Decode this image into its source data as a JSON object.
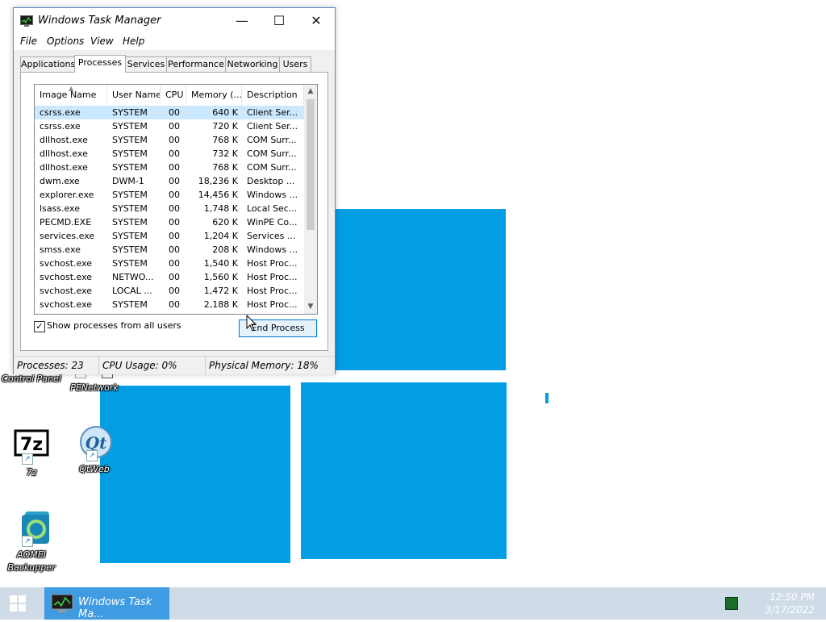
{
  "desktop": {
    "icons": [
      {
        "label": "Control Panel"
      },
      {
        "label": "PENetwork"
      },
      {
        "label": "7z"
      },
      {
        "label": "QtWeb"
      },
      {
        "label": "AOMEI Backupper"
      }
    ],
    "wallpaper_color": "#019ee3"
  },
  "taskbar": {
    "task_button_label": "Windows Task Ma...",
    "clock_time": "12:50 PM",
    "clock_date": "3/17/2022",
    "accent": "#3f9be2"
  },
  "task_manager": {
    "title": "Windows Task Manager",
    "menu": [
      "File",
      "Options",
      "View",
      "Help"
    ],
    "tabs": [
      "Applications",
      "Processes",
      "Services",
      "Performance",
      "Networking",
      "Users"
    ],
    "active_tab": "Processes",
    "columns": [
      "Image Name",
      "User Name",
      "CPU",
      "Memory (...",
      "Description"
    ],
    "rows": [
      {
        "name": "csrss.exe",
        "user": "SYSTEM",
        "cpu": "00",
        "mem": "640 K",
        "desc": "Client Ser..."
      },
      {
        "name": "csrss.exe",
        "user": "SYSTEM",
        "cpu": "00",
        "mem": "720 K",
        "desc": "Client Ser..."
      },
      {
        "name": "dllhost.exe",
        "user": "SYSTEM",
        "cpu": "00",
        "mem": "768 K",
        "desc": "COM Surr..."
      },
      {
        "name": "dllhost.exe",
        "user": "SYSTEM",
        "cpu": "00",
        "mem": "732 K",
        "desc": "COM Surr..."
      },
      {
        "name": "dllhost.exe",
        "user": "SYSTEM",
        "cpu": "00",
        "mem": "768 K",
        "desc": "COM Surr..."
      },
      {
        "name": "dwm.exe",
        "user": "DWM-1",
        "cpu": "00",
        "mem": "18,236 K",
        "desc": "Desktop ..."
      },
      {
        "name": "explorer.exe",
        "user": "SYSTEM",
        "cpu": "00",
        "mem": "14,456 K",
        "desc": "Windows ..."
      },
      {
        "name": "lsass.exe",
        "user": "SYSTEM",
        "cpu": "00",
        "mem": "1,748 K",
        "desc": "Local Sec..."
      },
      {
        "name": "PECMD.EXE",
        "user": "SYSTEM",
        "cpu": "00",
        "mem": "620 K",
        "desc": "WinPE Co..."
      },
      {
        "name": "services.exe",
        "user": "SYSTEM",
        "cpu": "00",
        "mem": "1,204 K",
        "desc": "Services ..."
      },
      {
        "name": "smss.exe",
        "user": "SYSTEM",
        "cpu": "00",
        "mem": "208 K",
        "desc": "Windows ..."
      },
      {
        "name": "svchost.exe",
        "user": "SYSTEM",
        "cpu": "00",
        "mem": "1,540 K",
        "desc": "Host Proc..."
      },
      {
        "name": "svchost.exe",
        "user": "NETWO...",
        "cpu": "00",
        "mem": "1,560 K",
        "desc": "Host Proc..."
      },
      {
        "name": "svchost.exe",
        "user": "LOCAL ...",
        "cpu": "00",
        "mem": "1,472 K",
        "desc": "Host Proc..."
      },
      {
        "name": "svchost.exe",
        "user": "SYSTEM",
        "cpu": "00",
        "mem": "2,188 K",
        "desc": "Host Proc..."
      }
    ],
    "selected_row": 0,
    "show_all_users_label": "Show processes from all users",
    "show_all_users_checked": true,
    "end_process_label": "End Process",
    "status": {
      "processes": "Processes: 23",
      "cpu": "CPU Usage: 0%",
      "memory": "Physical Memory: 18%"
    },
    "selection_color": "#cce8ff"
  }
}
